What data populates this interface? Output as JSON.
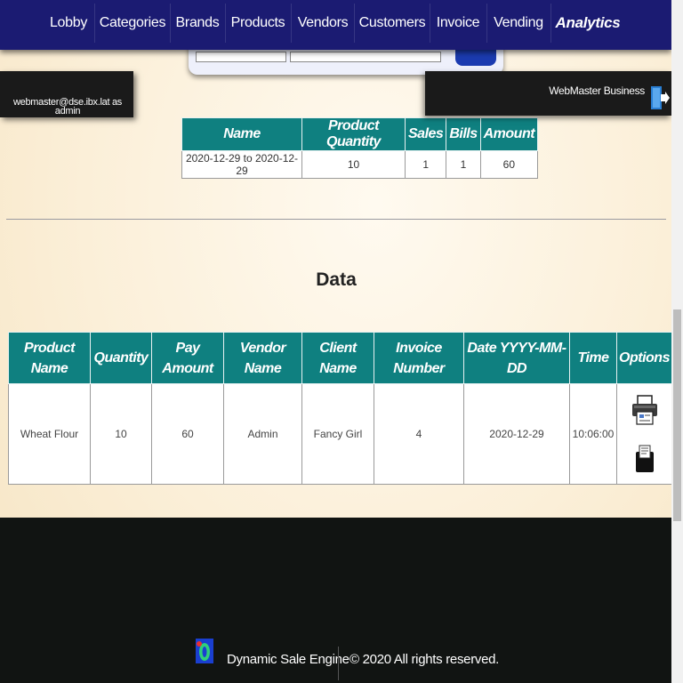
{
  "nav": {
    "items": [
      {
        "label": "Lobby"
      },
      {
        "label": "Categories"
      },
      {
        "label": "Brands"
      },
      {
        "label": "Products"
      },
      {
        "label": "Vendors"
      },
      {
        "label": "Customers"
      },
      {
        "label": "Invoice"
      },
      {
        "label": "Vending"
      },
      {
        "label": "Analytics"
      }
    ],
    "active": "Analytics",
    "background": "#1b1b72"
  },
  "user": {
    "text": "webmaster@dse.ibx.lat as admin"
  },
  "business": {
    "name": "WebMaster Business",
    "logout_icon": "logout-icon"
  },
  "summary": {
    "headers": [
      "Name",
      "Product Quantity",
      "Sales",
      "Bills",
      "Amount"
    ],
    "rows": [
      [
        "2020-12-29 to 2020-12-29",
        "10",
        "1",
        "1",
        "60"
      ]
    ]
  },
  "data_section": {
    "title": "Data",
    "headers": [
      "Product Name",
      "Quantity",
      "Pay Amount",
      "Vendor Name",
      "Client Name",
      "Invoice Number",
      "Date YYYY-MM-DD",
      "Time",
      "Options"
    ],
    "rows": [
      {
        "product_name": "Wheat Flour",
        "quantity": "10",
        "pay_amount": "60",
        "vendor_name": "Admin",
        "client_name": "Fancy Girl",
        "invoice_number": "4",
        "date": "2020-12-29",
        "time": "10:06:00",
        "options": [
          "printer-icon",
          "receipt-icon"
        ]
      }
    ]
  },
  "footer": {
    "brand": "Dynamic Sale Engine",
    "copyright": "© 2020 All rights reserved."
  },
  "colors": {
    "header_teal": "#0f8080",
    "footer_bg": "#111412"
  }
}
